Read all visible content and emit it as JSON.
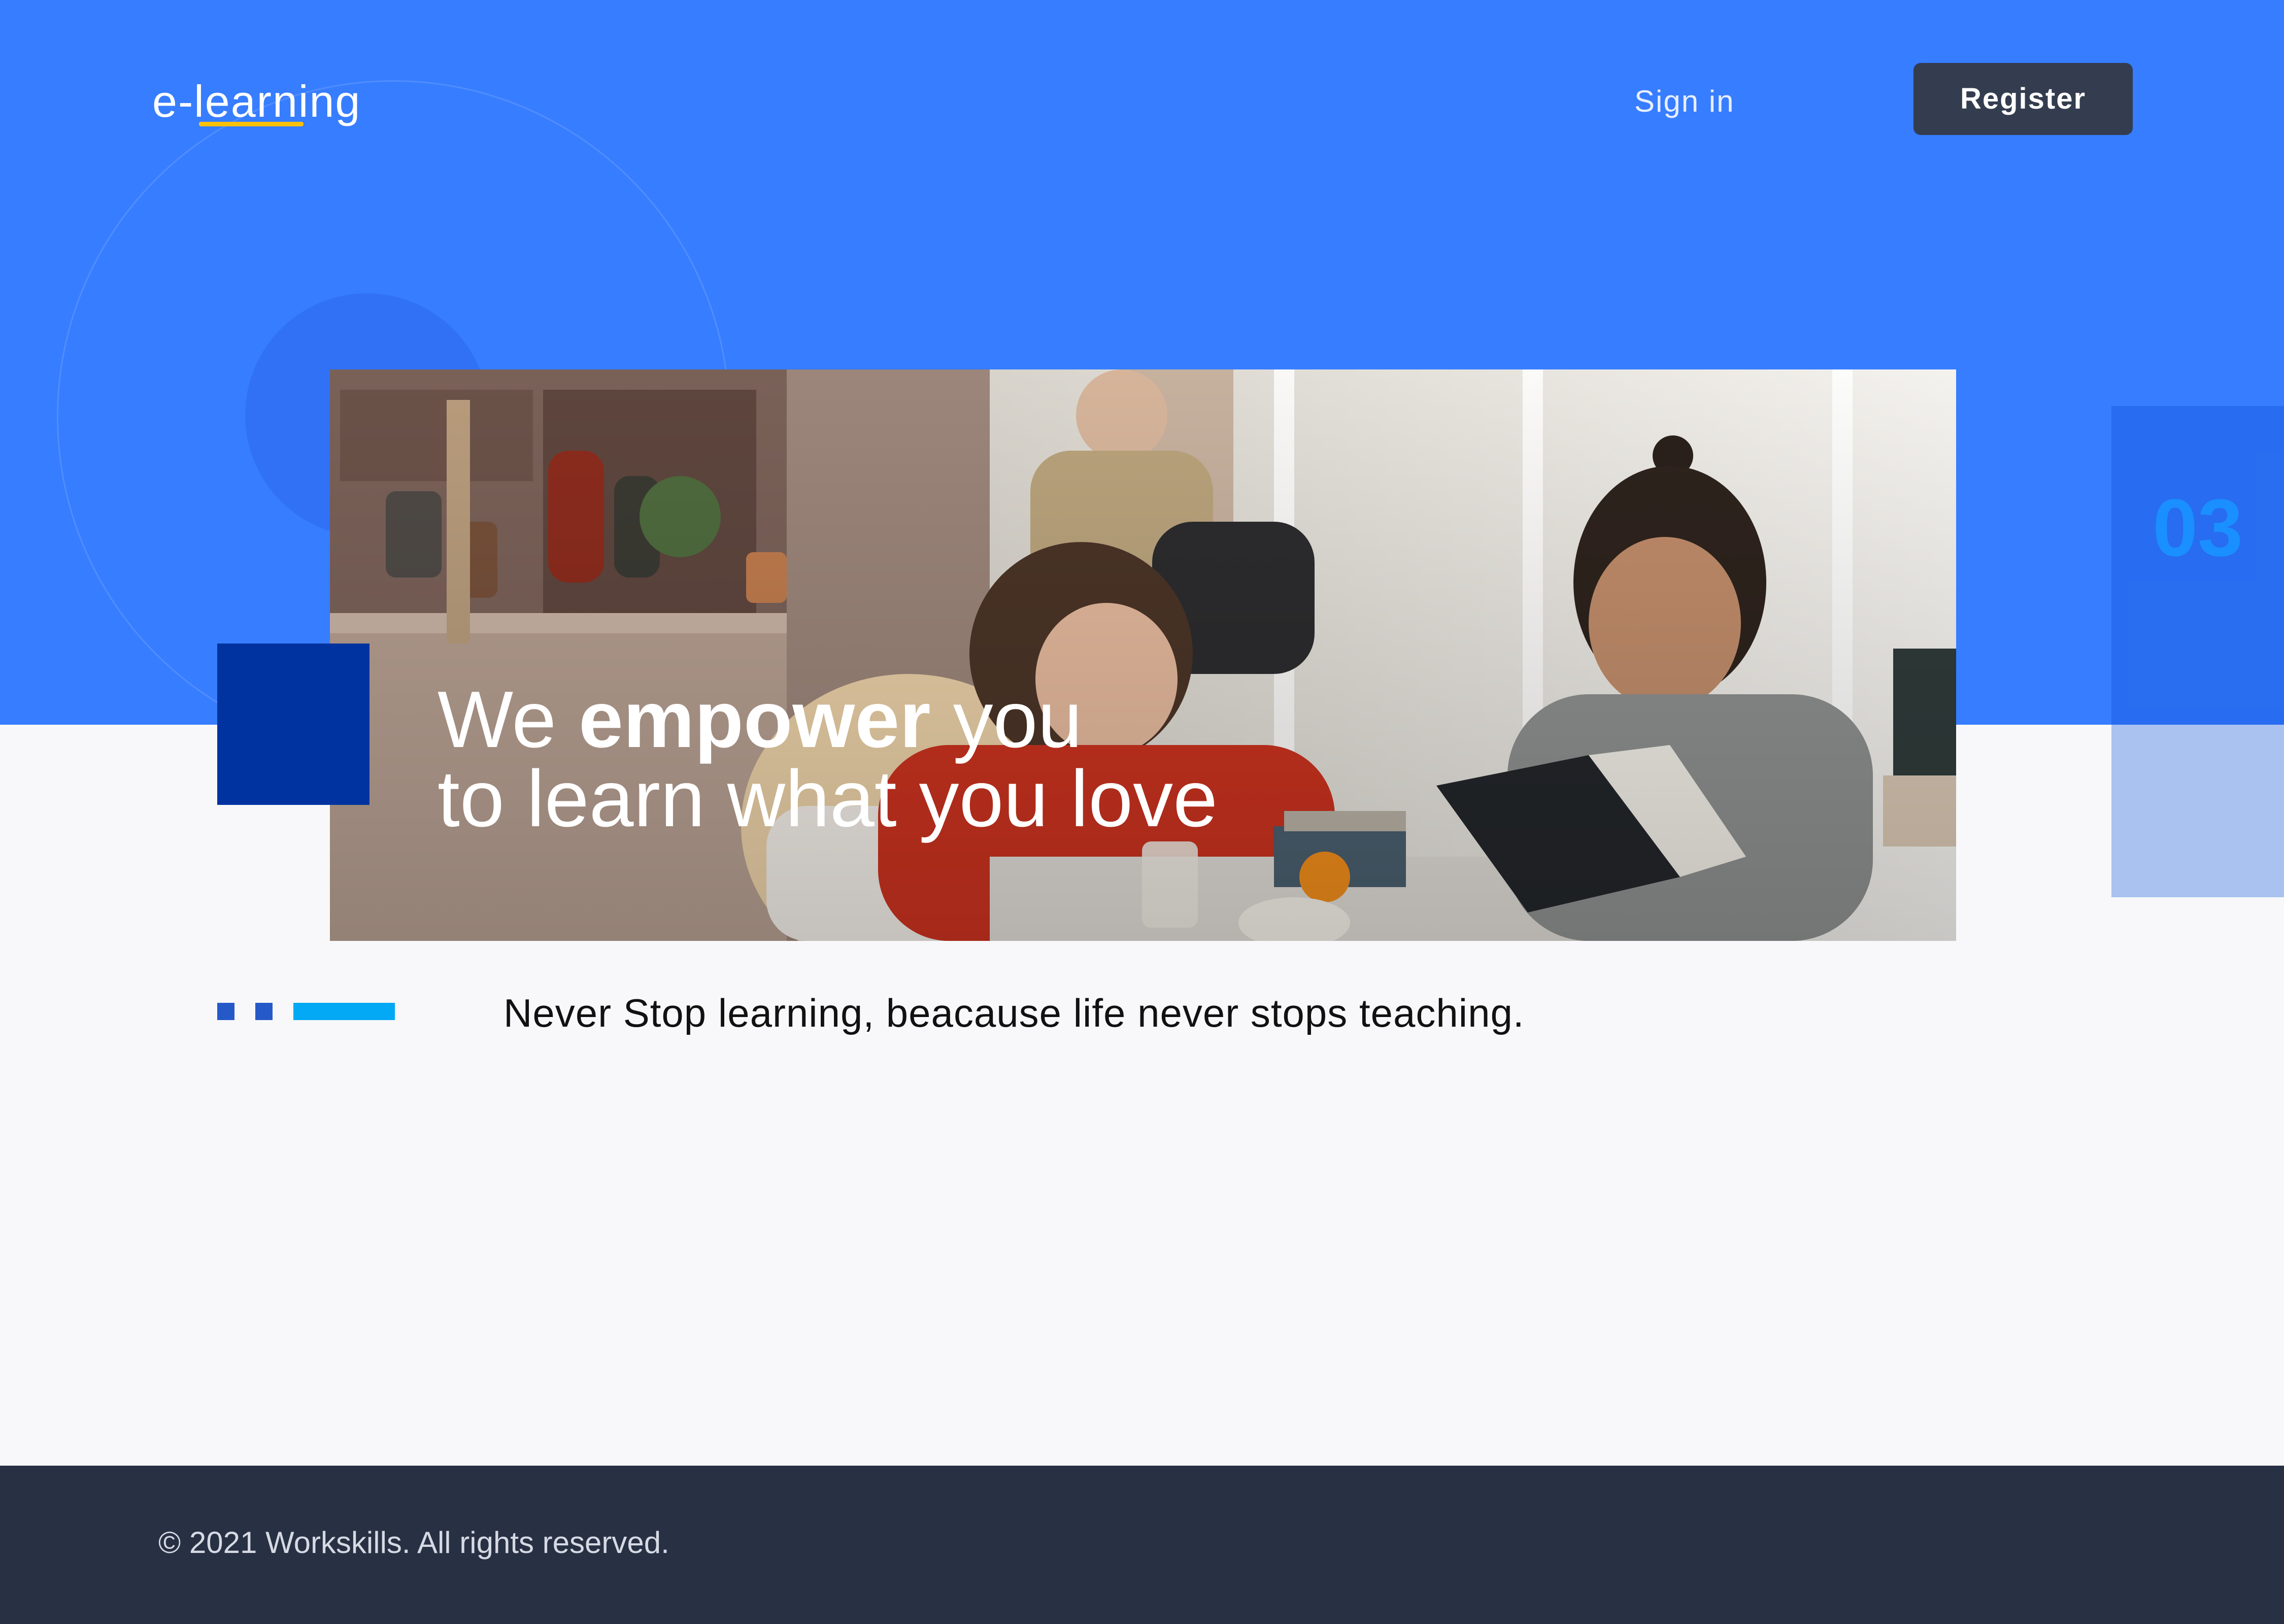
{
  "brand": {
    "logo_text": "e-learning",
    "accent_color": "#ffc107",
    "primary_color": "#377dff"
  },
  "nav": {
    "signin_label": "Sign in",
    "register_label": "Register"
  },
  "hero": {
    "headline_line1_pre": "We ",
    "headline_line1_strong": "empower",
    "headline_line1_post": " you",
    "headline_line2": "to learn what you love",
    "slide_number": "03",
    "image_alt": "group-studying-photo"
  },
  "carousel": {
    "slide_count": 3,
    "active_index": 2
  },
  "tagline": "Never Stop learning, beacause life never stops teaching.",
  "footer": {
    "copyright": "© 2021 Workskills. All rights reserved."
  }
}
